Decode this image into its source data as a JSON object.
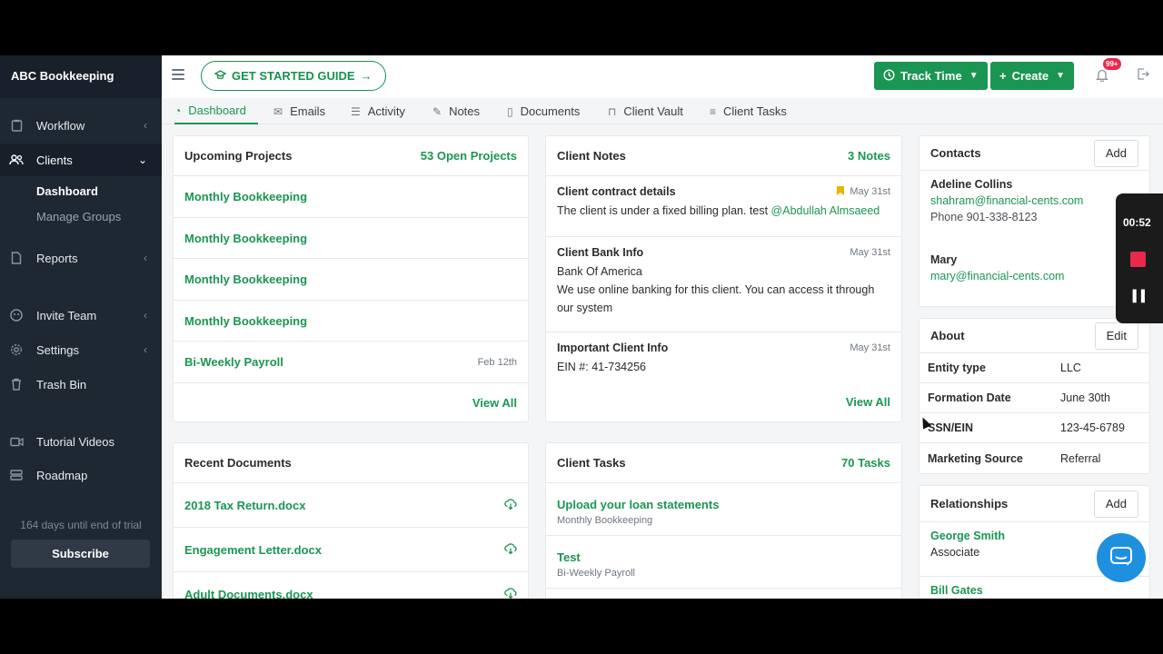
{
  "sidebar": {
    "brand": "ABC Bookkeeping",
    "items": [
      {
        "label": "Workflow",
        "icon": "clipboard-icon"
      },
      {
        "label": "Clients",
        "icon": "users-icon"
      },
      {
        "label": "Reports",
        "icon": "file-icon"
      },
      {
        "label": "Invite Team",
        "icon": "invite-icon"
      },
      {
        "label": "Settings",
        "icon": "gear-icon"
      },
      {
        "label": "Trash Bin",
        "icon": "trash-icon"
      },
      {
        "label": "Tutorial Videos",
        "icon": "video-icon"
      },
      {
        "label": "Roadmap",
        "icon": "roadmap-icon"
      }
    ],
    "subitems": [
      "Dashboard",
      "Manage Groups"
    ],
    "trial_text": "164 days until end of trial",
    "subscribe": "Subscribe"
  },
  "topbar": {
    "guide": "GET STARTED GUIDE",
    "track_time": "Track Time",
    "create": "Create",
    "badge": "99+"
  },
  "tabs": [
    "Dashboard",
    "Emails",
    "Activity",
    "Notes",
    "Documents",
    "Client Vault",
    "Client Tasks"
  ],
  "projects": {
    "title": "Upcoming Projects",
    "count": "53 Open Projects",
    "rows": [
      {
        "name": "Monthly Bookkeeping",
        "date": ""
      },
      {
        "name": "Monthly Bookkeeping",
        "date": ""
      },
      {
        "name": "Monthly Bookkeeping",
        "date": ""
      },
      {
        "name": "Monthly Bookkeeping",
        "date": ""
      },
      {
        "name": "Bi-Weekly Payroll",
        "date": "Feb 12th"
      }
    ],
    "view_all": "View All"
  },
  "notes": {
    "title": "Client Notes",
    "count": "3 Notes",
    "items": [
      {
        "title": "Client contract details",
        "date": "May 31st",
        "body": "The client is under a fixed billing plan. test ",
        "mention": "@Abdullah Almsaeed"
      },
      {
        "title": "Client Bank Info",
        "date": "May 31st",
        "line1": "Bank Of America",
        "line2": "We use online banking for this client. You can access it through our system"
      },
      {
        "title": "Important Client Info",
        "date": "May 31st",
        "body": "EIN #: 41-734256"
      }
    ],
    "view_all": "View All"
  },
  "documents": {
    "title": "Recent Documents",
    "rows": [
      "2018 Tax Return.docx",
      "Engagement Letter.docx",
      "Adult Documents.docx"
    ]
  },
  "tasks": {
    "title": "Client Tasks",
    "count": "70 Tasks",
    "rows": [
      {
        "name": "Upload your loan statements",
        "project": "Monthly Bookkeeping"
      },
      {
        "name": "Test",
        "project": "Bi-Weekly Payroll"
      }
    ]
  },
  "contacts": {
    "title": "Contacts",
    "add": "Add",
    "people": [
      {
        "name": "Adeline Collins",
        "email": "shahram@financial-cents.com",
        "phone": "Phone 901-338-8123"
      },
      {
        "name": "Mary",
        "email": "mary@financial-cents.com"
      }
    ]
  },
  "about": {
    "title": "About",
    "edit": "Edit",
    "rows": [
      {
        "k": "Entity type",
        "v": "LLC"
      },
      {
        "k": "Formation Date",
        "v": "June 30th"
      },
      {
        "k": "SSN/EIN",
        "v": "123-45-6789"
      },
      {
        "k": "Marketing Source",
        "v": "Referral"
      }
    ]
  },
  "relationships": {
    "title": "Relationships",
    "add": "Add",
    "people": [
      {
        "name": "George Smith",
        "role": "Associate"
      },
      {
        "name": "Bill Gates"
      }
    ]
  },
  "recorder": {
    "time": "00:52"
  },
  "colors": {
    "accent": "#1a9652",
    "sidebar": "#1e2833",
    "badge": "#e8294c"
  }
}
